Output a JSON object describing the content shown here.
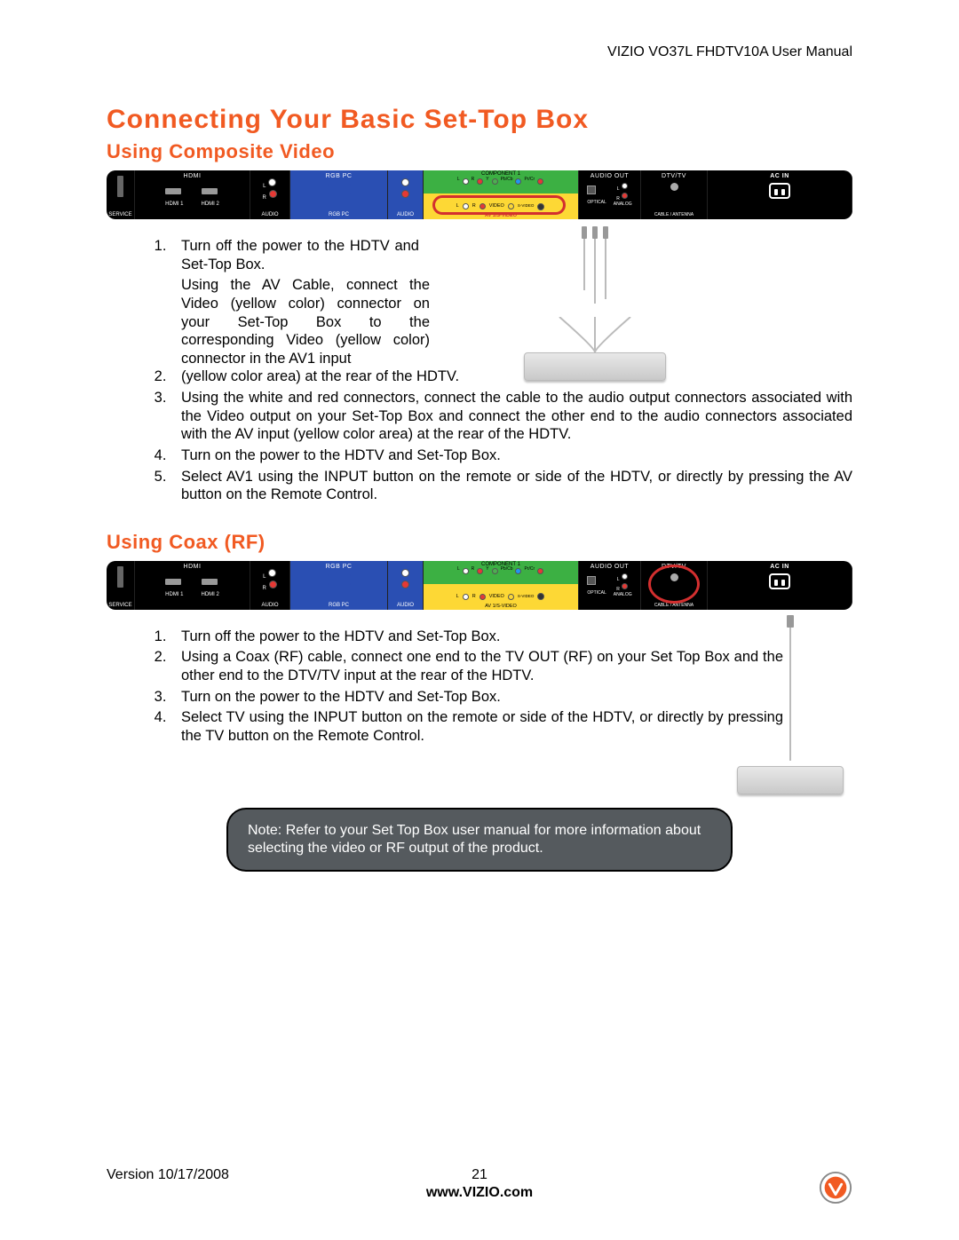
{
  "header": {
    "product": "VIZIO VO37L FHDTV10A User Manual"
  },
  "titles": {
    "main": "Connecting Your Basic Set-Top Box",
    "sub1": "Using Composite Video",
    "sub2": "Using Coax (RF)"
  },
  "panel": {
    "sections": {
      "hdmi": "HDMI",
      "service": "SERVICE",
      "hdmi1": "HDMI 1",
      "hdmi2": "HDMI 2",
      "audio": "AUDIO",
      "l": "L",
      "r": "R",
      "rgbpc": "RGB PC",
      "component1": "COMPONENT 1",
      "y": "Y",
      "pbcb": "Pb/Cb",
      "prcr": "Pr/Cr",
      "video": "VIDEO",
      "svideo": "S-VIDEO",
      "av1s": "AV 1/S-VIDEO",
      "audioout": "AUDIO OUT",
      "optical": "OPTICAL",
      "analog": "ANALOG",
      "dtv": "DTV/TV",
      "cable": "CABLE / ANTENNA",
      "acin": "AC IN"
    }
  },
  "steps_composite": [
    "Turn off the power to the HDTV and Set-Top Box.",
    "Using the AV Cable, connect the Video (yellow color) connector on your Set-Top Box to the corresponding Video (yellow color) connector in the AV1 input (yellow color area) at the rear of the HDTV.",
    "Using the white and red connectors, connect the cable to the audio output connectors associated with the Video output on your Set-Top Box and connect the other end to the audio connectors associated with the AV input (yellow color area) at the rear of the HDTV.",
    "Turn on the power to the HDTV and Set-Top Box.",
    "Select AV1 using the INPUT button on the remote or side of the HDTV, or directly by pressing the AV button on the Remote Control."
  ],
  "steps_coax": [
    "Turn off the power to the HDTV and Set-Top Box.",
    "Using a Coax (RF) cable, connect one end to the TV OUT (RF) on your Set Top Box and the other end to the DTV/TV input at the rear of the HDTV.",
    "Turn on the power to the HDTV and Set-Top Box.",
    "Select TV using the INPUT button on the remote or side of the HDTV, or directly by pressing the TV button on the Remote Control."
  ],
  "note": "Note: Refer to your Set Top Box user manual for more information about selecting the video or RF output of the product.",
  "footer": {
    "version": "Version 10/17/2008",
    "page": "21",
    "url": "www.VIZIO.com"
  }
}
